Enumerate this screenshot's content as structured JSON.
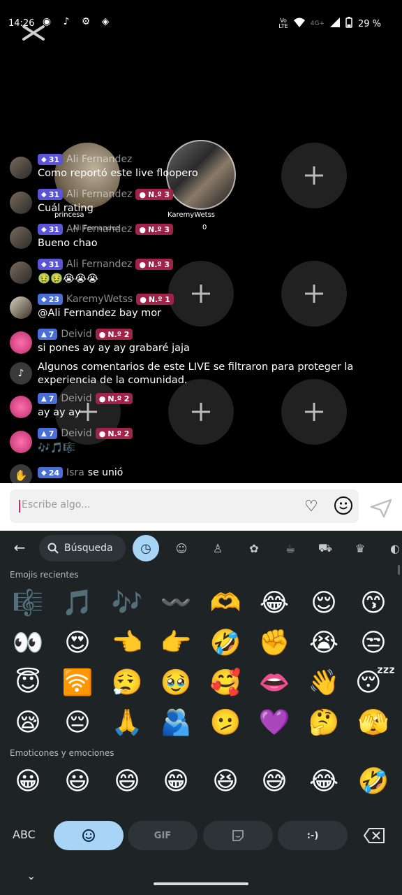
{
  "status_bar": {
    "time": "14:26",
    "battery": "29 %",
    "network": "4G+",
    "volte": "Vo LTE"
  },
  "guest_grid": {
    "host_name_left": "princesa",
    "host_name_right": "KaremyWetss",
    "host_sub": "Ali Fernandez",
    "host_count": "0"
  },
  "chat": {
    "messages": [
      {
        "user": "Ali Fernandez",
        "level": "31",
        "fan": "N.º 3",
        "text": "Como reportó este live floopero"
      },
      {
        "user": "Ali Fernandez",
        "level": "31",
        "fan": "N.º 3",
        "text": "Cuál rating"
      },
      {
        "user": "Ali Fernandez",
        "level": "31",
        "fan": "N.º 3",
        "text": "Bueno chao"
      },
      {
        "user": "Ali Fernandez",
        "level": "31",
        "fan": "N.º 3",
        "text": "🤢🤢😭😭😭"
      },
      {
        "user": "KaremyWetss",
        "level": "23",
        "fan": "N.º 1",
        "text": "@Ali Fernandez bay mor"
      },
      {
        "user": "Deivid",
        "level": "7",
        "fan": "N.º 2",
        "text": "si pones ay ay ay grabaré jaja"
      },
      {
        "system": "Algunos comentarios de este LIVE se filtraron para proteger la experiencia de la comunidad."
      },
      {
        "user": "Deivid",
        "level": "7",
        "fan": "N.º 2",
        "text": "ay ay ay"
      },
      {
        "user": "Deivid",
        "level": "7",
        "fan": "N.º 2",
        "text": "🎶🎵🎼"
      },
      {
        "user": "Isra",
        "level": "24",
        "text": "se unió"
      }
    ]
  },
  "input": {
    "placeholder": "Escribe algo..."
  },
  "keyboard": {
    "search_label": "Búsqueda",
    "section_recent": "Emojis recientes",
    "section_smileys": "Emoticones y emociones",
    "recent_emojis": [
      "🎼",
      "🎵",
      "🎶",
      "〰️",
      "🫶",
      "😂",
      "😌",
      "😙",
      "👀",
      "😍",
      "👈",
      "👉",
      "🤣",
      "✊",
      "😭",
      "😒",
      "😇",
      "🛜",
      "😮‍💨",
      "🥹",
      "🥰",
      "👄",
      "👋",
      "😴",
      "😪",
      "😔",
      "🙏",
      "🫂",
      "🫤",
      "💜",
      "🤔",
      "🫣"
    ],
    "smiley_emojis": [
      "😀",
      "😃",
      "😄",
      "😁",
      "😆",
      "😅",
      "😂",
      "🤣"
    ],
    "bottom": {
      "abc": "ABC",
      "gif": "GIF",
      "emoticon": ":-)"
    }
  }
}
